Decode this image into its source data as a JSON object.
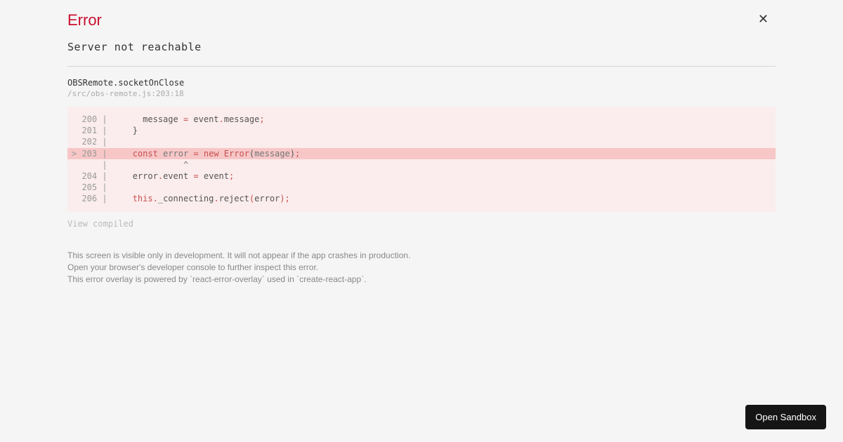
{
  "header": {
    "title": "Error",
    "close_glyph": "✕"
  },
  "error": {
    "message": "Server not reachable",
    "function_name": "OBSRemote.socketOnClose",
    "location": "/src/obs-remote.js:203:18"
  },
  "code": {
    "lines": [
      {
        "num": "200",
        "prefix": "  ",
        "hl": false,
        "tokens": [
          {
            "t": "      message ",
            "c": "plain"
          },
          {
            "t": "=",
            "c": "op"
          },
          {
            "t": " event",
            "c": "plain"
          },
          {
            "t": ".",
            "c": "op"
          },
          {
            "t": "message",
            "c": "plain"
          },
          {
            "t": ";",
            "c": "op"
          }
        ]
      },
      {
        "num": "201",
        "prefix": "  ",
        "hl": false,
        "tokens": [
          {
            "t": "    }",
            "c": "plain"
          }
        ]
      },
      {
        "num": "202",
        "prefix": "  ",
        "hl": false,
        "tokens": []
      },
      {
        "num": "203",
        "prefix": "> ",
        "hl": true,
        "tokens": [
          {
            "t": "    ",
            "c": "plain"
          },
          {
            "t": "const",
            "c": "kw"
          },
          {
            "t": " error ",
            "c": "id"
          },
          {
            "t": "=",
            "c": "op"
          },
          {
            "t": " ",
            "c": "plain"
          },
          {
            "t": "new",
            "c": "kw"
          },
          {
            "t": " ",
            "c": "plain"
          },
          {
            "t": "Error",
            "c": "kw"
          },
          {
            "t": "(",
            "c": "plain"
          },
          {
            "t": "message",
            "c": "id"
          },
          {
            "t": ")",
            "c": "plain"
          },
          {
            "t": ";",
            "c": "op"
          }
        ]
      },
      {
        "num": "   ",
        "prefix": "  ",
        "hl": false,
        "tokens": [
          {
            "t": "              ^",
            "c": "id"
          }
        ]
      },
      {
        "num": "204",
        "prefix": "  ",
        "hl": false,
        "tokens": [
          {
            "t": "    error",
            "c": "plain"
          },
          {
            "t": ".",
            "c": "op"
          },
          {
            "t": "event ",
            "c": "plain"
          },
          {
            "t": "=",
            "c": "op"
          },
          {
            "t": " event",
            "c": "plain"
          },
          {
            "t": ";",
            "c": "op"
          }
        ]
      },
      {
        "num": "205",
        "prefix": "  ",
        "hl": false,
        "tokens": []
      },
      {
        "num": "206",
        "prefix": "  ",
        "hl": false,
        "tokens": [
          {
            "t": "    ",
            "c": "plain"
          },
          {
            "t": "this",
            "c": "kw"
          },
          {
            "t": ".",
            "c": "op"
          },
          {
            "t": "_connecting",
            "c": "plain"
          },
          {
            "t": ".",
            "c": "op"
          },
          {
            "t": "reject",
            "c": "plain"
          },
          {
            "t": "(",
            "c": "op"
          },
          {
            "t": "error",
            "c": "plain"
          },
          {
            "t": ")",
            "c": "op"
          },
          {
            "t": ";",
            "c": "op"
          }
        ]
      }
    ],
    "view_compiled_label": "View compiled"
  },
  "footer": {
    "line1": "This screen is visible only in development. It will not appear if the app crashes in production.",
    "line2": "Open your browser's developer console to further inspect this error.",
    "line3": "This error overlay is powered by `react-error-overlay` used in `create-react-app`."
  },
  "sandbox_button": "Open Sandbox"
}
